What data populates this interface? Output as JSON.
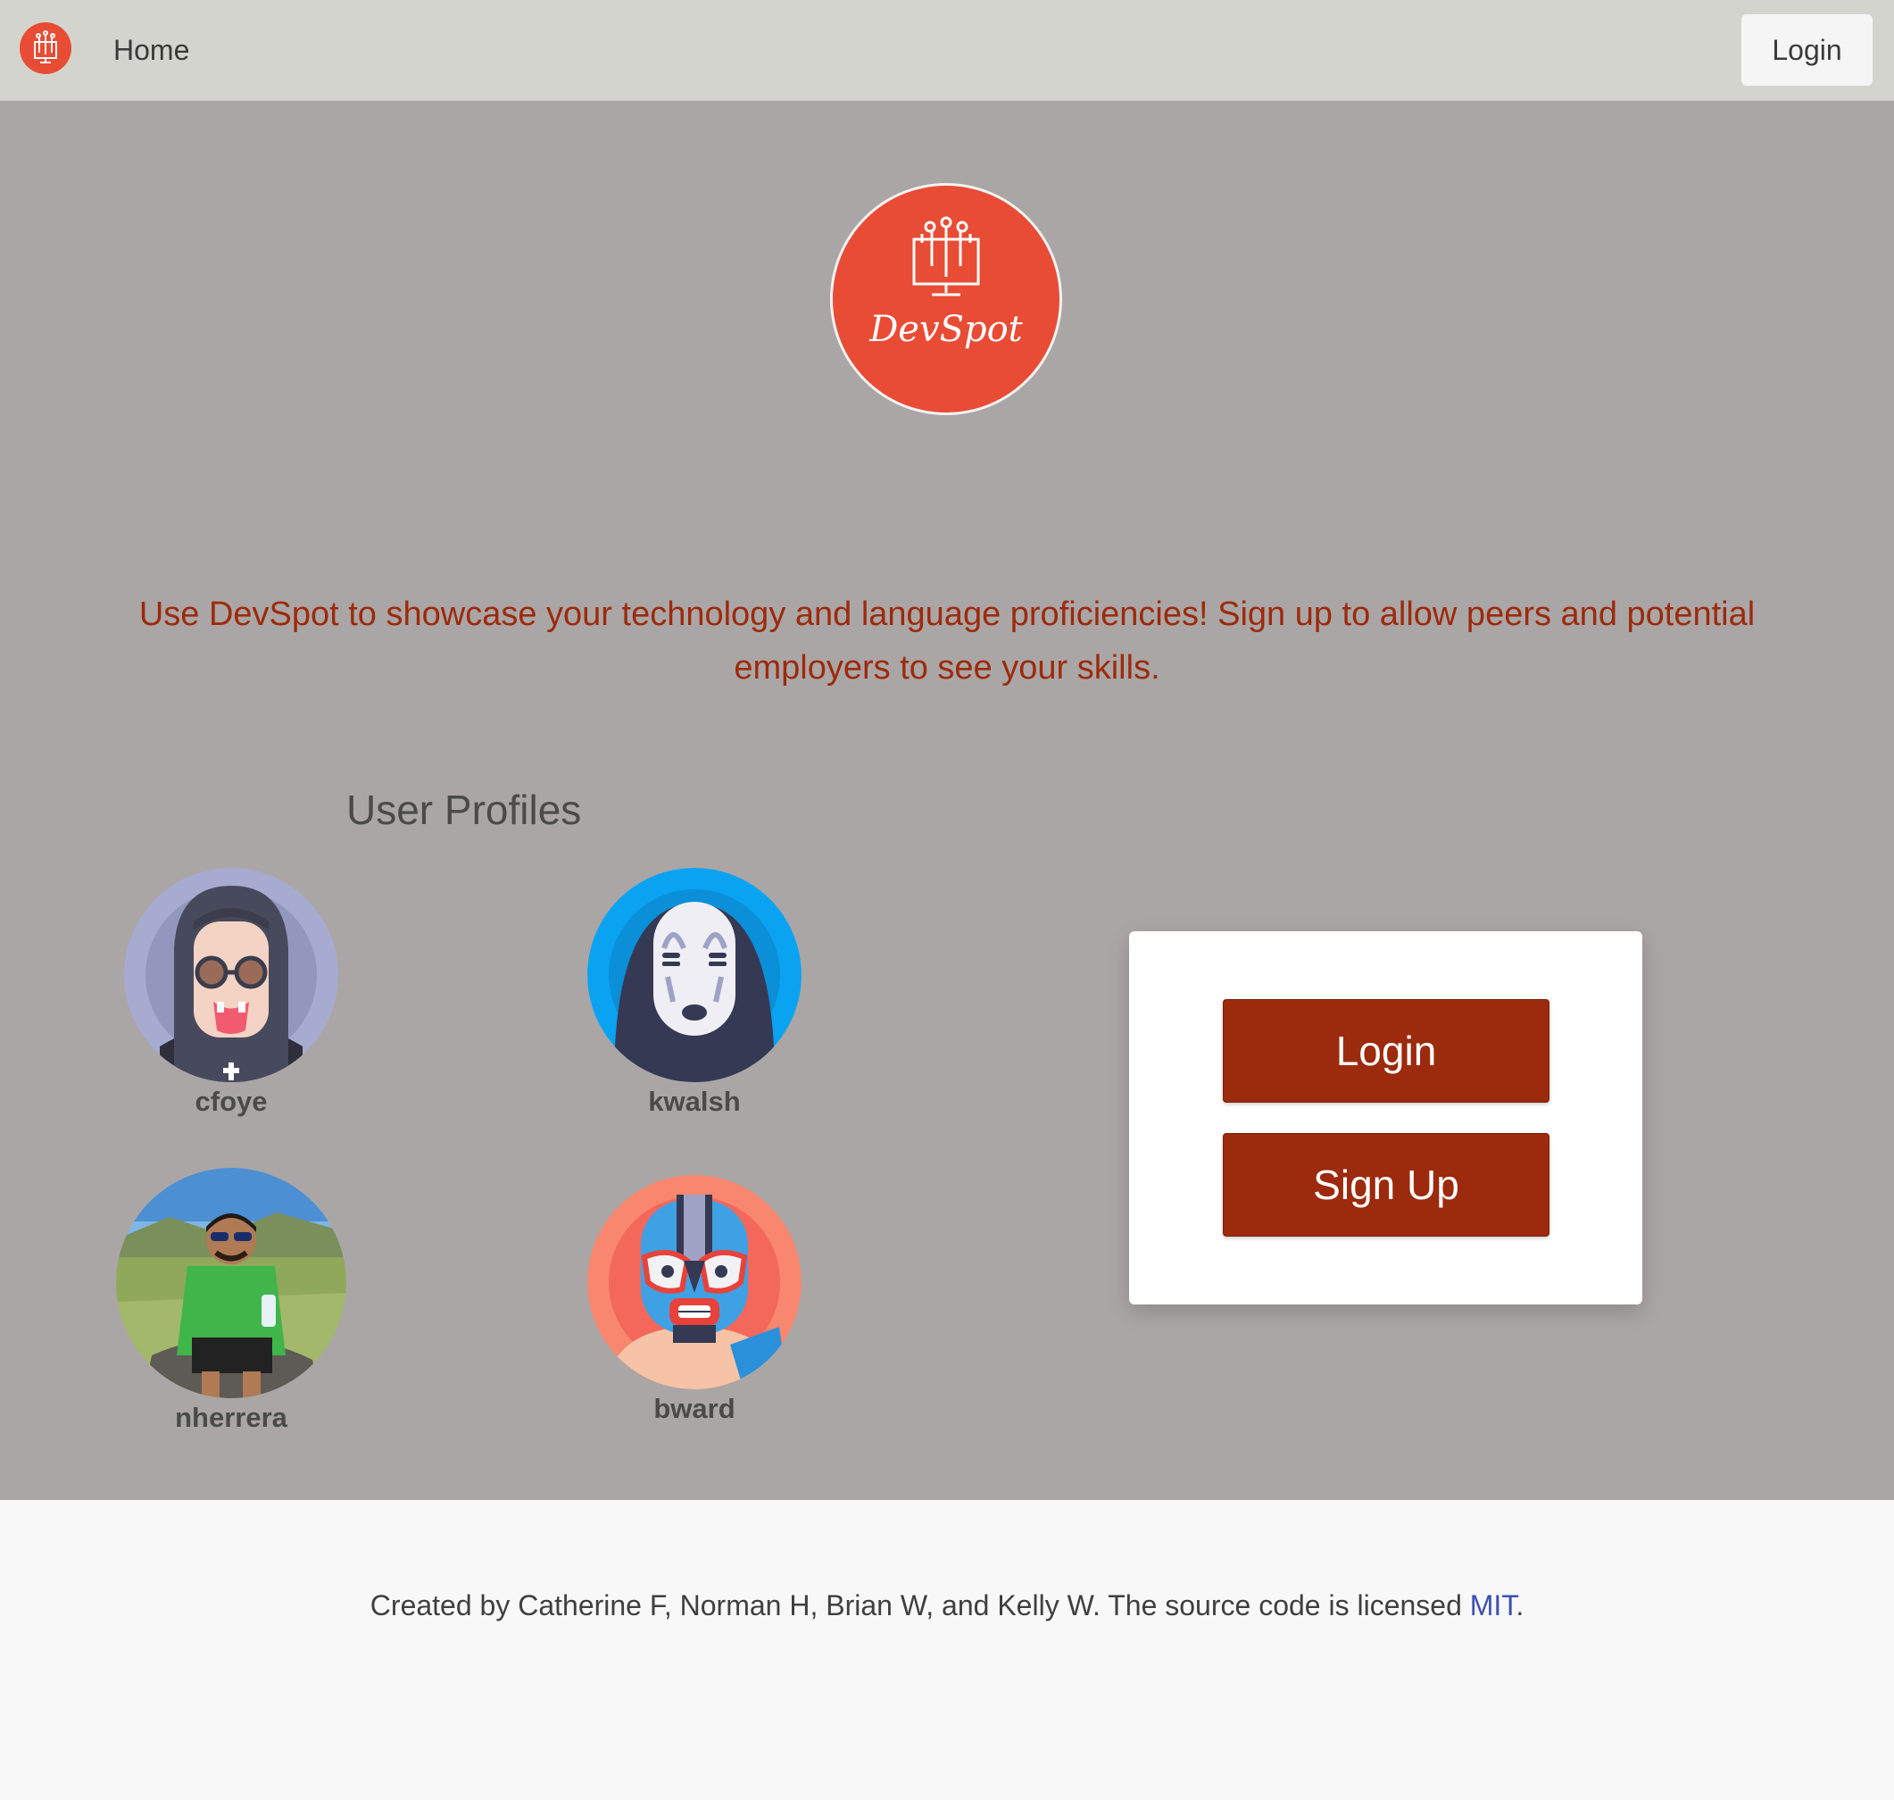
{
  "nav": {
    "logo_icon": "devspot-monitor-icon",
    "home_label": "Home",
    "login_label": "Login"
  },
  "hero": {
    "brand_name": "DevSpot",
    "tagline": "Use DevSpot to showcase your technology and language proficiencies! Sign up to allow peers and potential employers to see your skills.",
    "profiles_title": "User Profiles",
    "profiles": [
      {
        "username": "cfoye",
        "avatar": "ozzy-character-avatar"
      },
      {
        "username": "kwalsh",
        "avatar": "no-face-character-avatar"
      },
      {
        "username": "nherrera",
        "avatar": "photo-avatar-hiker"
      },
      {
        "username": "bward",
        "avatar": "luchador-mask-avatar"
      }
    ]
  },
  "auth": {
    "login_label": "Login",
    "signup_label": "Sign Up"
  },
  "footer": {
    "text": "Created by Catherine F, Norman H, Brian W, and Kelly W. The source code is licensed ",
    "link_label": "MIT",
    "suffix": "."
  },
  "colors": {
    "brand": "#e84c35",
    "accent": "#9c2a0c",
    "hero_bg": "#aba6a6",
    "nav_bg": "#d4d4ce",
    "link": "#3b4fb3"
  }
}
